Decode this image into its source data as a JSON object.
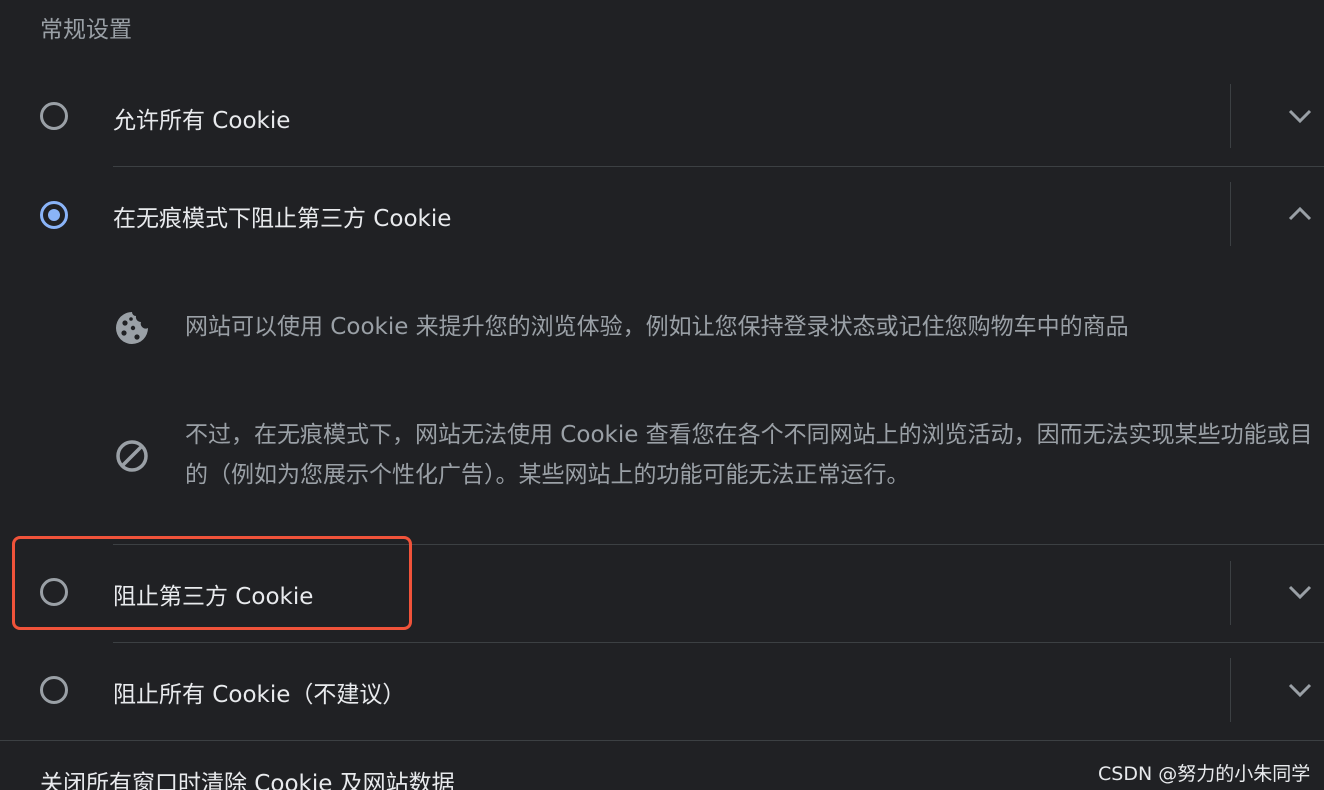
{
  "section_title": "常规设置",
  "options": [
    {
      "label": "允许所有 Cookie",
      "selected": false,
      "expanded": false
    },
    {
      "label": "在无痕模式下阻止第三方 Cookie",
      "selected": true,
      "expanded": true
    },
    {
      "label": "阻止第三方 Cookie",
      "selected": false,
      "expanded": false
    },
    {
      "label": "阻止所有 Cookie（不建议）",
      "selected": false,
      "expanded": false
    }
  ],
  "expanded_details": [
    {
      "icon": "cookie-icon",
      "text": "网站可以使用 Cookie 来提升您的浏览体验，例如让您保持登录状态或记住您购物车中的商品"
    },
    {
      "icon": "block-icon",
      "text": "不过，在无痕模式下，网站无法使用 Cookie 查看您在各个不同网站上的浏览活动，因而无法实现某些功能或目的（例如为您展示个性化广告）。某些网站上的功能可能无法正常运行。"
    }
  ],
  "bottom_setting_title": "关闭所有窗口时清除 Cookie 及网站数据",
  "watermark": "CSDN @努力的小朱同学",
  "colors": {
    "background": "#202124",
    "accent": "#8ab4f8",
    "highlight_border": "#f0533a",
    "text_primary": "#e8eaed",
    "text_secondary": "#9aa0a6",
    "divider": "#3c4043"
  }
}
